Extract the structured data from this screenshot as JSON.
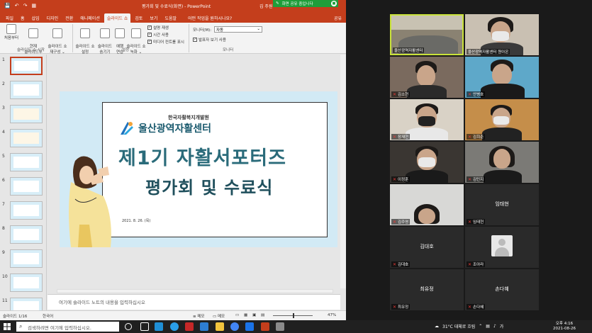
{
  "ppt": {
    "window_title": "평가회 및 수료식(화면)  -  PowerPoint",
    "user": "김 주원",
    "quick_access": [
      "💾",
      "↶",
      "↷",
      "▦"
    ],
    "tabs": [
      "파일",
      "홈",
      "삽입",
      "디자인",
      "전환",
      "애니메이션",
      "슬라이드 쇼",
      "검토",
      "보기",
      "도움말"
    ],
    "active_tab": "슬라이드 쇼",
    "tell_me": "어떤 작업을 원하시나요?",
    "share_label": "공유",
    "ribbon": {
      "buttons": [
        {
          "label": "처음부터",
          "icon": "play-from-start-icon"
        },
        {
          "label": "현재\n슬라이드부터",
          "icon": "play-current-icon"
        },
        {
          "label": "슬라이드 쇼\n재구성 ⌄",
          "icon": "custom-show-icon"
        },
        {
          "label": "슬라이드 쇼\n설정",
          "icon": "setup-show-icon"
        },
        {
          "label": "슬라이드\n숨기기",
          "icon": "hide-slide-icon"
        },
        {
          "label": "예행\n연습",
          "icon": "rehearse-icon"
        },
        {
          "label": "슬라이드 쇼\n녹화 ⌄",
          "icon": "record-icon"
        }
      ],
      "checks": [
        {
          "label": "설명 재생",
          "checked": true
        },
        {
          "label": "시간 사용",
          "checked": true
        },
        {
          "label": "미디어 컨트롤 표시",
          "checked": true
        },
        {
          "label": "발표자 보기 사용",
          "checked": true
        }
      ],
      "monitor_label": "모니터(M):",
      "monitor_value": "자동",
      "groups": [
        "슬라이드 쇼 시작",
        "설정",
        "모니터"
      ]
    },
    "thumbnail_numbers": [
      "1",
      "2",
      "3",
      "4",
      "5",
      "6",
      "7",
      "8",
      "9",
      "10",
      "11"
    ],
    "slide": {
      "org_line1": "한국자활복지개발원",
      "org_line2": "울산광역자활센터",
      "title_line1": "제1기 자활서포터즈",
      "title_line2": "평가회 및 수료식",
      "date": "2021. 8. 26. (목)"
    },
    "notes_placeholder": "여기에 슬라이드 노트의 내용을 입력하십시오",
    "status": {
      "slide_info": "슬라이드 1/16",
      "language": "한국어",
      "notes_btn": "≡ 메모",
      "comments_btn": "▭ 메모",
      "zoom": "47%"
    }
  },
  "share_banner": "화면 공유 중입니다",
  "zoom": {
    "tiles": [
      {
        "name": "울산광역자활센터",
        "video": true,
        "muted": false
      },
      {
        "name": "울산광역자활센터 원아온",
        "video": true,
        "muted": false
      },
      {
        "name": "김소현",
        "video": true,
        "muted": true
      },
      {
        "name": "안병호",
        "video": true,
        "muted": true
      },
      {
        "name": "장재현",
        "video": true,
        "muted": true
      },
      {
        "name": "김희춘",
        "video": true,
        "muted": true
      },
      {
        "name": "이정훈",
        "video": true,
        "muted": true
      },
      {
        "name": "김민지",
        "video": true,
        "muted": true
      },
      {
        "name": "김주영",
        "video": true,
        "muted": true
      },
      {
        "name": "임태현",
        "video": false,
        "muted": true,
        "bigname": "임태현"
      },
      {
        "name": "김대호",
        "video": false,
        "muted": true,
        "bigname": "김대호"
      },
      {
        "name": "조아라",
        "video": false,
        "muted": true,
        "avatar": true
      },
      {
        "name": "최유정",
        "video": false,
        "muted": true,
        "bigname": "최유정"
      },
      {
        "name": "손다혜",
        "video": false,
        "muted": true,
        "bigname": "손다혜"
      }
    ]
  },
  "taskbar": {
    "search_placeholder": "검색하려면 여기에 입력하십시오.",
    "weather": "31°C 대체로 흐림",
    "ime": "가",
    "time": "오후 4:16",
    "date": "2021-08-26"
  }
}
